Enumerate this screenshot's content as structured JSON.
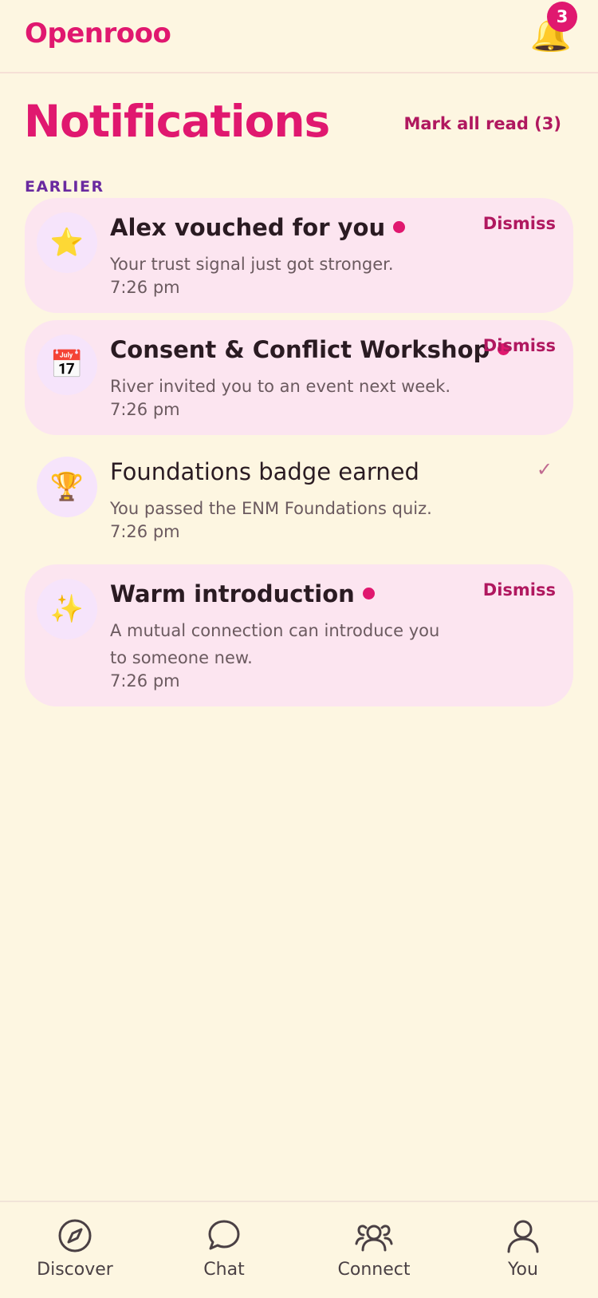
{
  "app": {
    "brand": "Openrooo"
  },
  "header": {
    "bell_badge_count": "3"
  },
  "page": {
    "title": "Notifications",
    "mark_all_label": "Mark all read (3)",
    "section_label": "EARLIER"
  },
  "notifications": [
    {
      "icon": "⭐",
      "icon_name": "star-icon",
      "title": "Alex vouched for you",
      "body": "Your trust signal just got stronger.",
      "time": "7:26 pm",
      "unread": true,
      "action": "Dismiss"
    },
    {
      "icon": "📅",
      "icon_name": "calendar-icon",
      "title": "Consent & Conflict Workshop",
      "body": "River invited you to an event next week.",
      "time": "7:26 pm",
      "unread": true,
      "action": "Dismiss"
    },
    {
      "icon": "🏆",
      "icon_name": "trophy-icon",
      "title": "Foundations badge earned",
      "body": "You passed the ENM Foundations quiz.",
      "time": "7:26 pm",
      "unread": false,
      "action": "✓"
    },
    {
      "icon": "✨",
      "icon_name": "sparkles-icon",
      "title": "Warm introduction",
      "body": "A mutual connection can introduce you to someone new.",
      "time": "7:26 pm",
      "unread": true,
      "action": "Dismiss"
    }
  ],
  "nav": {
    "items": [
      {
        "label": "Discover",
        "icon": "compass-icon"
      },
      {
        "label": "Chat",
        "icon": "chat-bubble-icon"
      },
      {
        "label": "Connect",
        "icon": "people-icon"
      },
      {
        "label": "You",
        "icon": "person-icon"
      }
    ]
  },
  "colors": {
    "accent": "#e0186f",
    "background": "#fdf6e1",
    "unread_card": "#fce5f0",
    "section": "#6a2aa0"
  }
}
